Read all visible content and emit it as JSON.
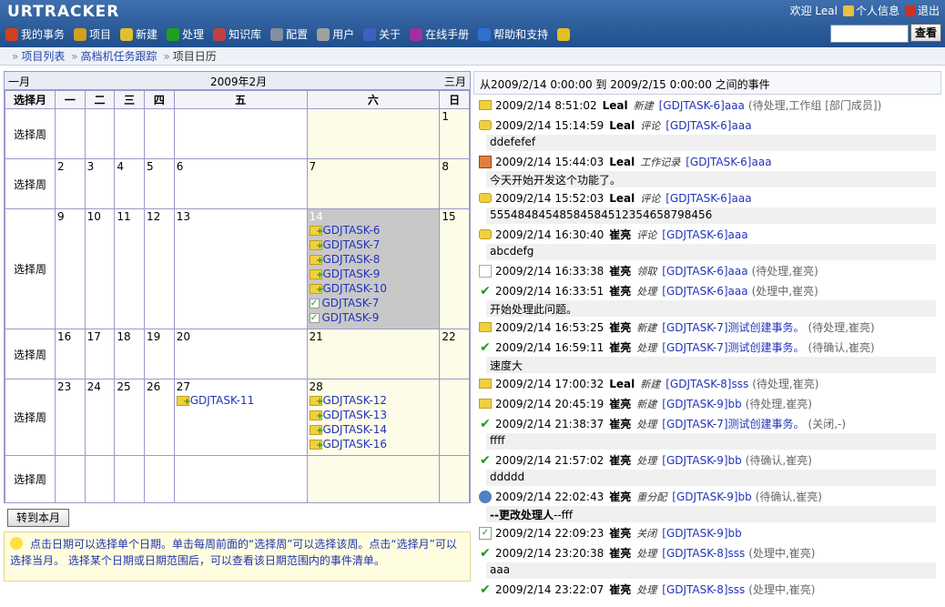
{
  "header": {
    "logo": "URTRACKER",
    "welcome": "欢迎 Leal",
    "profile": "个人信息",
    "logout": "退出",
    "search_button": "查看",
    "search_value": ""
  },
  "nav": [
    {
      "label": "我的事务",
      "icon": "home-icon",
      "color": "#d04020"
    },
    {
      "label": "项目",
      "icon": "database-icon",
      "color": "#d0a020"
    },
    {
      "label": "新建",
      "icon": "new-task-icon",
      "color": "#e0c030"
    },
    {
      "label": "处理",
      "icon": "check-icon",
      "color": "#20a020"
    },
    {
      "label": "知识库",
      "icon": "books-icon",
      "color": "#c04040"
    },
    {
      "label": "配置",
      "icon": "gear-icon",
      "color": "#8090a0"
    },
    {
      "label": "用户",
      "icon": "users-icon",
      "color": "#a0a0a0"
    },
    {
      "label": "关于",
      "icon": "info-icon",
      "color": "#4060c0"
    },
    {
      "label": "在线手册",
      "icon": "manual-icon",
      "color": "#a030a0"
    },
    {
      "label": "帮助和支持",
      "icon": "help-icon",
      "color": "#3070d0"
    },
    {
      "label": "",
      "icon": "star-icon",
      "color": "#e0c020"
    }
  ],
  "breadcrumb": {
    "items": [
      "项目列表",
      "高档机任务跟踪",
      "项目日历"
    ]
  },
  "calendar": {
    "prev": "一月",
    "title": "2009年2月",
    "next": "三月",
    "week_col": "选择月",
    "weekdays": [
      "一",
      "二",
      "三",
      "四",
      "五",
      "六",
      "日"
    ],
    "week_label": "选择周",
    "weeks": [
      {
        "days": [
          "",
          "",
          "",
          "",
          "",
          "",
          "1"
        ]
      },
      {
        "days": [
          "2",
          "3",
          "4",
          "5",
          "6",
          "7",
          "8"
        ]
      },
      {
        "days": [
          "9",
          "10",
          "11",
          "12",
          "13",
          "14",
          "15"
        ]
      },
      {
        "days": [
          "16",
          "17",
          "18",
          "19",
          "20",
          "21",
          "22"
        ]
      },
      {
        "days": [
          "23",
          "24",
          "25",
          "26",
          "27",
          "28",
          ""
        ]
      },
      {
        "days": [
          "",
          "",
          "",
          "",
          "",
          "",
          ""
        ]
      }
    ],
    "tasks_14": [
      {
        "name": "GDJTASK-6",
        "kind": "new"
      },
      {
        "name": "GDJTASK-7",
        "kind": "new"
      },
      {
        "name": "GDJTASK-8",
        "kind": "new"
      },
      {
        "name": "GDJTASK-9",
        "kind": "new"
      },
      {
        "name": "GDJTASK-10",
        "kind": "new"
      },
      {
        "name": "GDJTASK-7",
        "kind": "done"
      },
      {
        "name": "GDJTASK-9",
        "kind": "done"
      }
    ],
    "tasks_27": [
      {
        "name": "GDJTASK-11",
        "kind": "new"
      }
    ],
    "tasks_28": [
      {
        "name": "GDJTASK-12",
        "kind": "new"
      },
      {
        "name": "GDJTASK-13",
        "kind": "new"
      },
      {
        "name": "GDJTASK-14",
        "kind": "new"
      },
      {
        "name": "GDJTASK-16",
        "kind": "new"
      }
    ]
  },
  "this_month_button": "转到本月",
  "tip": "点击日期可以选择单个日期。单击每周前面的“选择周”可以选择该周。点击“选择月”可以选择当月。 选择某个日期或日期范围后，可以查看该日期范围内的事件清单。",
  "events_title": "从2009/2/14 0:00:00 到 2009/2/15 0:00:00 之间的事件",
  "events": [
    {
      "icon": "new",
      "time": "2009/2/14 8:51:02",
      "user": "Leal",
      "action": "新建",
      "task": "[GDJTASK-6]aaa",
      "status": "(待处理,工作组 [部门成员])",
      "body": ""
    },
    {
      "icon": "comment",
      "time": "2009/2/14 15:14:59",
      "user": "Leal",
      "action": "评论",
      "task": "[GDJTASK-6]aaa",
      "status": "",
      "body": "ddefefef"
    },
    {
      "icon": "log",
      "time": "2009/2/14 15:44:03",
      "user": "Leal",
      "action": "工作记录",
      "task": "[GDJTASK-6]aaa",
      "status": "",
      "body": "今天开始开发这个功能了。"
    },
    {
      "icon": "comment",
      "time": "2009/2/14 15:52:03",
      "user": "Leal",
      "action": "评论",
      "task": "[GDJTASK-6]aaa",
      "status": "",
      "body": "55548484548584584512354658798456"
    },
    {
      "icon": "comment",
      "time": "2009/2/14 16:30:40",
      "user": "崔亮",
      "action": "评论",
      "task": "[GDJTASK-6]aaa",
      "status": "",
      "body": "abcdefg"
    },
    {
      "icon": "doc",
      "time": "2009/2/14 16:33:38",
      "user": "崔亮",
      "action": "领取",
      "task": "[GDJTASK-6]aaa",
      "status": "(待处理,崔亮)",
      "body": ""
    },
    {
      "icon": "check",
      "time": "2009/2/14 16:33:51",
      "user": "崔亮",
      "action": "处理",
      "task": "[GDJTASK-6]aaa",
      "status": "(处理中,崔亮)",
      "body": "开始处理此问题。"
    },
    {
      "icon": "new",
      "time": "2009/2/14 16:53:25",
      "user": "崔亮",
      "action": "新建",
      "task": "[GDJTASK-7]测试创建事务。",
      "status": "(待处理,崔亮)",
      "body": ""
    },
    {
      "icon": "check",
      "time": "2009/2/14 16:59:11",
      "user": "崔亮",
      "action": "处理",
      "task": "[GDJTASK-7]测试创建事务。",
      "status": "(待确认,崔亮)",
      "body": "速度大"
    },
    {
      "icon": "new",
      "time": "2009/2/14 17:00:32",
      "user": "Leal",
      "action": "新建",
      "task": "[GDJTASK-8]sss",
      "status": "(待处理,崔亮)",
      "body": ""
    },
    {
      "icon": "new",
      "time": "2009/2/14 20:45:19",
      "user": "崔亮",
      "action": "新建",
      "task": "[GDJTASK-9]bb",
      "status": "(待处理,崔亮)",
      "body": ""
    },
    {
      "icon": "check",
      "time": "2009/2/14 21:38:37",
      "user": "崔亮",
      "action": "处理",
      "task": "[GDJTASK-7]测试创建事务。",
      "status": "(关闭,-)",
      "body": "ffff"
    },
    {
      "icon": "check",
      "time": "2009/2/14 21:57:02",
      "user": "崔亮",
      "action": "处理",
      "task": "[GDJTASK-9]bb",
      "status": "(待确认,崔亮)",
      "body": "ddddd"
    },
    {
      "icon": "person",
      "time": "2009/2/14 22:02:43",
      "user": "崔亮",
      "action": "重分配",
      "task": "[GDJTASK-9]bb",
      "status": "(待确认,崔亮)",
      "body": "--更改处理人--fff",
      "body_bold": "--更改处理人",
      "body_rest": "--fff"
    },
    {
      "icon": "box",
      "time": "2009/2/14 22:09:23",
      "user": "崔亮",
      "action": "关闭",
      "task": "[GDJTASK-9]bb",
      "status": "",
      "body": ""
    },
    {
      "icon": "check",
      "time": "2009/2/14 23:20:38",
      "user": "崔亮",
      "action": "处理",
      "task": "[GDJTASK-8]sss",
      "status": "(处理中,崔亮)",
      "body": "aaa"
    },
    {
      "icon": "check",
      "time": "2009/2/14 23:22:07",
      "user": "崔亮",
      "action": "处理",
      "task": "[GDJTASK-8]sss",
      "status": "(处理中,崔亮)",
      "body": ""
    }
  ]
}
